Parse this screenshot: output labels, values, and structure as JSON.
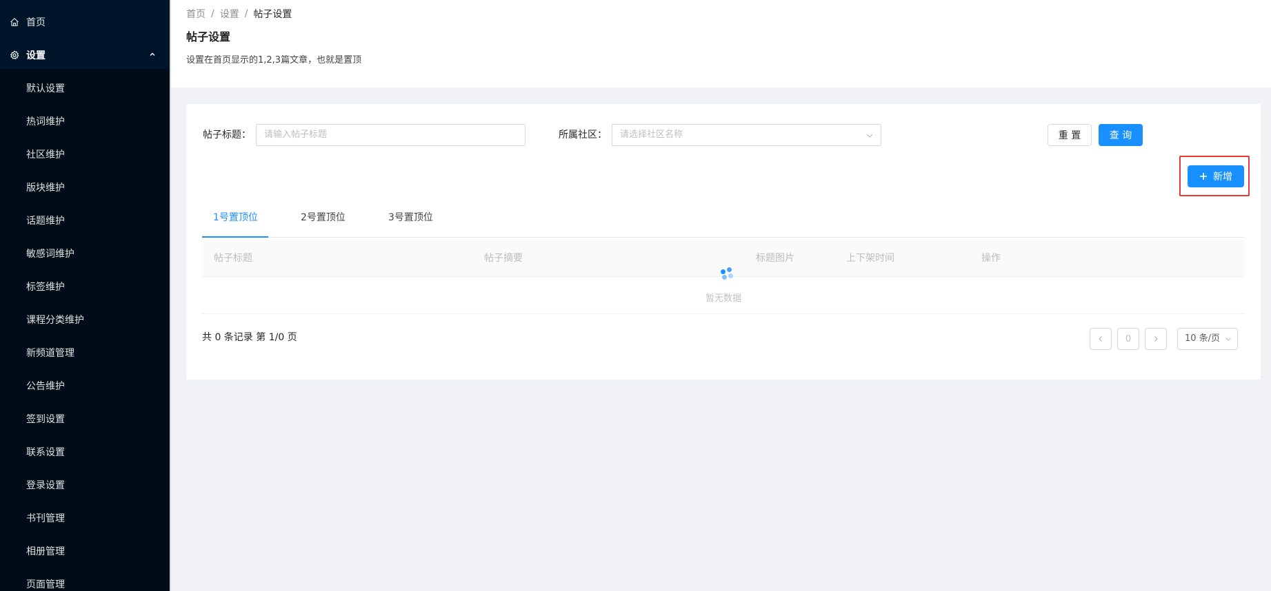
{
  "sidebar": {
    "home_label": "首页",
    "settings_label": "设置",
    "sub_items": [
      "默认设置",
      "热词维护",
      "社区维护",
      "版块维护",
      "话题维护",
      "敏感词维护",
      "标签维护",
      "课程分类维护",
      "新频道管理",
      "公告维护",
      "签到设置",
      "联系设置",
      "登录设置",
      "书刊管理",
      "相册管理",
      "页面管理"
    ]
  },
  "breadcrumb": {
    "home": "首页",
    "sep": "/",
    "settings": "设置",
    "current": "帖子设置"
  },
  "header": {
    "title": "帖子设置",
    "description": "设置在首页显示的1,2,3篇文章，也就是置顶"
  },
  "filters": {
    "title_label": "帖子标题：",
    "title_placeholder": "请输入帖子标题",
    "community_label": "所属社区：",
    "community_placeholder": "请选择社区名称",
    "reset_label": "重 置",
    "query_label": "查 询"
  },
  "toolbar": {
    "add_label": "新增"
  },
  "tabs": [
    "1号置顶位",
    "2号置顶位",
    "3号置顶位"
  ],
  "table": {
    "columns": [
      "帖子标题",
      "帖子摘要",
      "标题图片",
      "上下架时间",
      "操作"
    ],
    "empty_text": "暂无数据"
  },
  "pagination": {
    "total_text": "共 0 条记录 第 1/0 页",
    "current_page": "0",
    "page_size": "10 条/页"
  },
  "colors": {
    "sidebar_bg": "#001529",
    "primary": "#1890ff",
    "highlight": "#e53935"
  }
}
